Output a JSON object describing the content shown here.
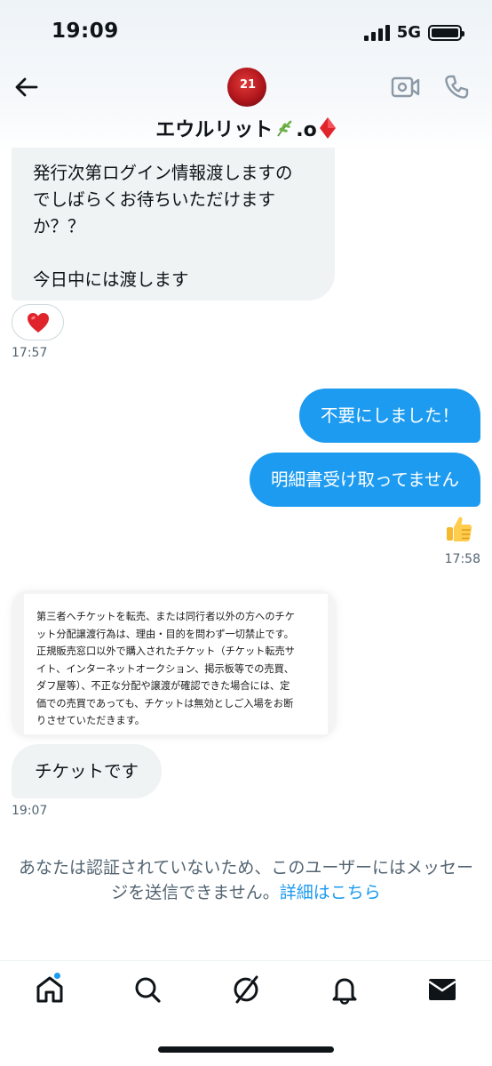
{
  "status_bar": {
    "time": "19:09",
    "network": "5G"
  },
  "header": {
    "user_name": "エウルリット",
    "name_suffix": ".o",
    "avatar_jersey": "21"
  },
  "messages": {
    "received_1": "発行次第ログイン情報渡しますの\nでしばらくお待ちいただけます\nか？？\n\n今日中には渡します",
    "reaction": "heart",
    "time_1": "17:57",
    "sent_1": "不要にしました！",
    "sent_2": "明細書受け取ってません",
    "sent_reaction": "thumbs-up",
    "time_2": "17:58",
    "ticket_notice": "第三者へチケットを転売、または同行者以外の方へのチケ\nット分配譲渡行為は、理由・目的を問わず一切禁止です。\n正規販売窓口以外で購入されたチケット（チケット転売サ\nイト、インターネットオークション、掲示板等での売買、\nダフ屋等）、不正な分配や譲渡が確認できた場合には、定\n価での売買であっても、チケットは無効としご入場をお断\nりさせていただきます。",
    "received_2": "チケットです",
    "time_3": "19:07"
  },
  "notice": {
    "text": "あなたは認証されていないため、このユーザーにはメッセージを送信できません。",
    "link": "詳細はこちら"
  },
  "tabbar": {
    "items": [
      "home",
      "search",
      "grok",
      "notifications",
      "messages"
    ]
  },
  "colors": {
    "accent": "#1d9bf0",
    "bubble_in": "#eff3f4",
    "text_secondary": "#536471"
  }
}
